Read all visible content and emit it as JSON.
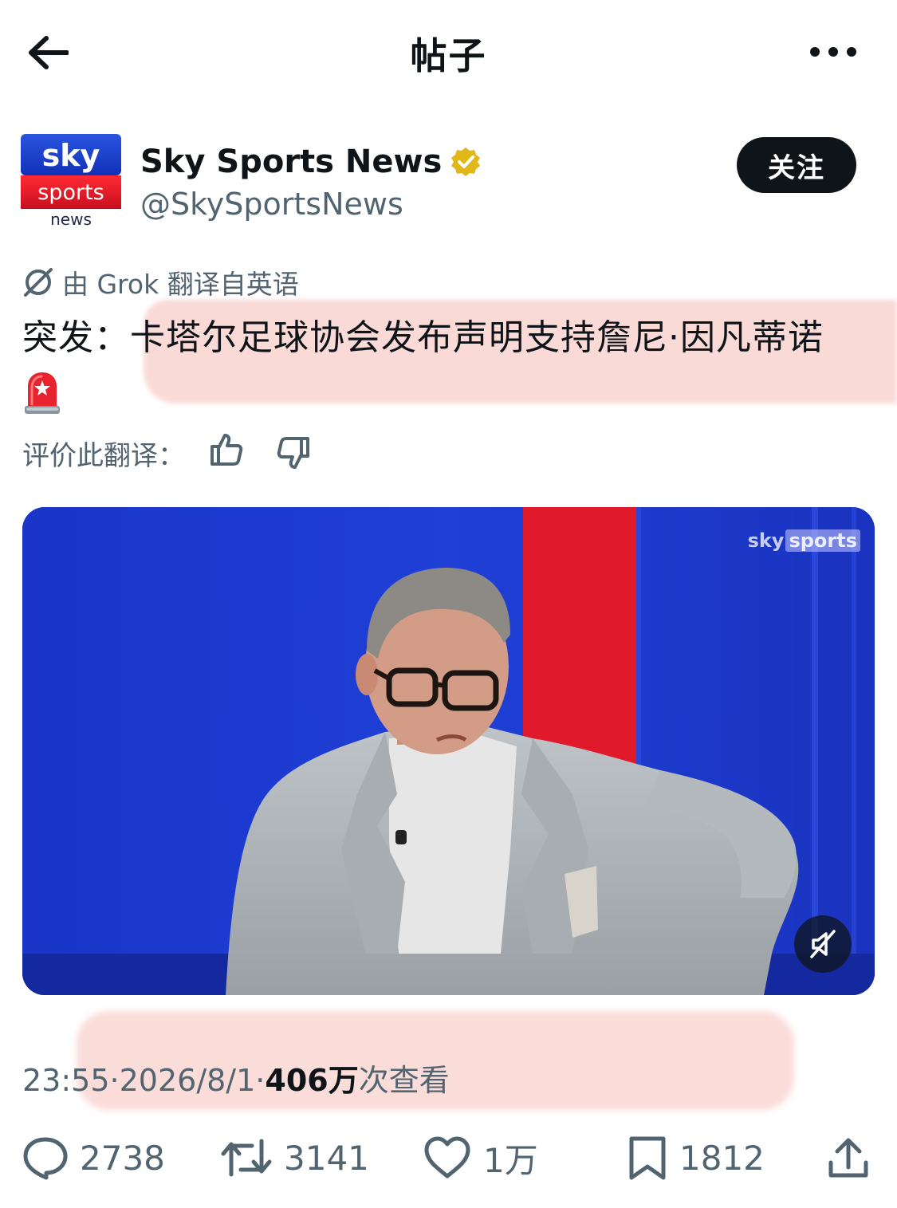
{
  "header": {
    "title": "帖子"
  },
  "author": {
    "avatar": {
      "line1": "sky",
      "line2": "sports",
      "line3": "news"
    },
    "name": "Sky Sports News",
    "handle": "@SkySportsNews",
    "verified_color": "#e2b719"
  },
  "follow_label": "关注",
  "translation": {
    "note": "由 Grok 翻译自英语",
    "text": "突发：卡塔尔足球协会发布声明支持詹尼·因凡蒂诺",
    "rate_label": "评价此翻译："
  },
  "video": {
    "watermark_sky": "sky",
    "watermark_sports": "sports"
  },
  "meta": {
    "time": "23:55",
    "sep1": " · ",
    "date": "2026/8/1",
    "sep2": " · ",
    "views": "406万",
    "views_label": " 次查看"
  },
  "actions": {
    "replies": "2738",
    "reposts": "3141",
    "likes": "1万",
    "bookmarks": "1812"
  },
  "colors": {
    "text_primary": "#0f1419",
    "text_secondary": "#536471",
    "highlight": "#f9d4d0",
    "sky_blue": "#1f3fd0",
    "sky_red": "#e0192b"
  }
}
